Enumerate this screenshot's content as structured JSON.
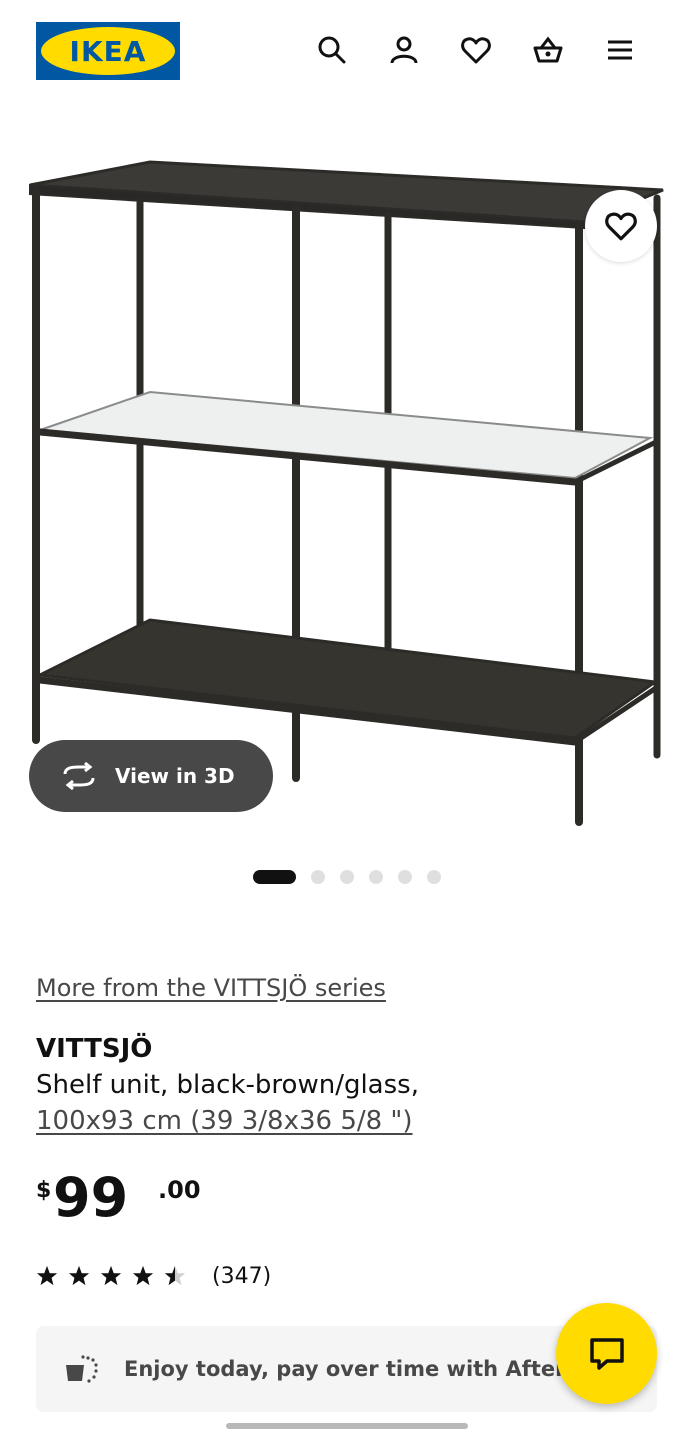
{
  "header": {
    "logo_text": "IKEA",
    "icons": [
      "search-icon",
      "account-icon",
      "favorites-icon",
      "basket-icon",
      "menu-icon"
    ]
  },
  "gallery": {
    "view3d_label": "View in 3D",
    "total_images": 6,
    "active_image": 1
  },
  "product": {
    "series_link": "More from the VITTSJÖ series",
    "name": "VITTSJÖ",
    "description": "Shelf unit, black-brown/glass,",
    "dimensions": "100x93 cm (39 3/8x36 5/8 \")",
    "price": {
      "currency": "$",
      "integer": "99",
      "decimal": ".00"
    },
    "rating": {
      "stars": 4.5,
      "max": 5,
      "count": "(347)"
    }
  },
  "afterpay": {
    "text": "Enjoy today, pay over time with Afterpay"
  },
  "colors": {
    "ikea_blue": "#0058a3",
    "ikea_yellow": "#ffdb00",
    "text_dark": "#111111",
    "text_muted": "#484848"
  }
}
